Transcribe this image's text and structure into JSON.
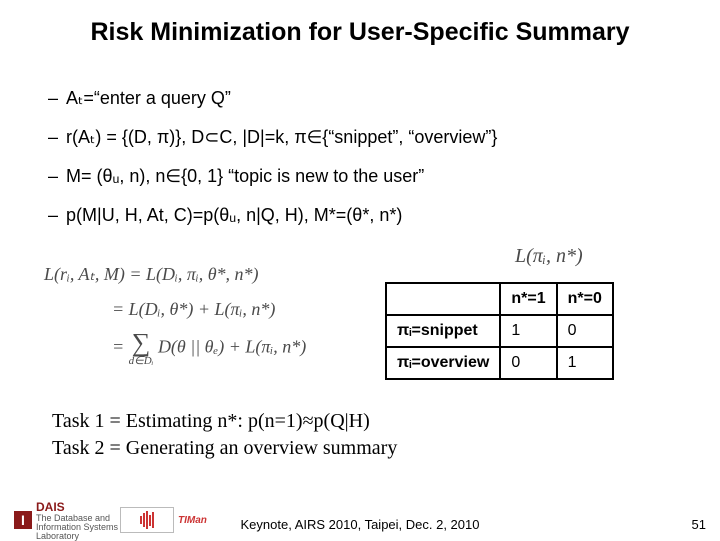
{
  "title": "Risk Minimization for User-Specific Summary",
  "bullets": [
    "Aₜ=“enter a query Q”",
    "r(Aₜ) = {(D, π)}, D⊂C, |D|=k, π∈{“snippet”, “overview”}",
    "M= (θᵤ, n), n∈{0, 1} “topic is new to the user”",
    "p(M|U, H, At, C)=p(θᵤ, n|Q, H), M*=(θ*, n*)"
  ],
  "equations": {
    "line1": "L(rᵢ, Aₜ, M) = L(Dᵢ, πᵢ, θ*, n*)",
    "line2": "= L(Dᵢ, θ*) + L(πᵢ, n*)",
    "line3_pre": "= ",
    "line3_sum_top": "",
    "line3_sum_bot": "d∈Dᵢ",
    "line3_post": " D(θ || θₑ) + L(πᵢ, n*)",
    "tail": "L(πᵢ, n*)"
  },
  "table": {
    "col1": "n*=1",
    "col2": "n*=0",
    "row1": "πᵢ=snippet",
    "row2": "πᵢ=overview",
    "cells": [
      [
        "1",
        "0"
      ],
      [
        "0",
        "1"
      ]
    ]
  },
  "tasks": {
    "t1": "Task 1 = Estimating n*: p(n=1)≈p(Q|H)",
    "t2": "Task 2 = Generating an overview summary"
  },
  "footer": "Keynote, AIRS 2010, Taipei, Dec. 2, 2010",
  "pagenum": "51",
  "logo1": {
    "letter": "I",
    "word": "DAIS",
    "caption": "The Database and Information Systems Laboratory"
  },
  "logo2": {
    "word": "TIMan"
  }
}
